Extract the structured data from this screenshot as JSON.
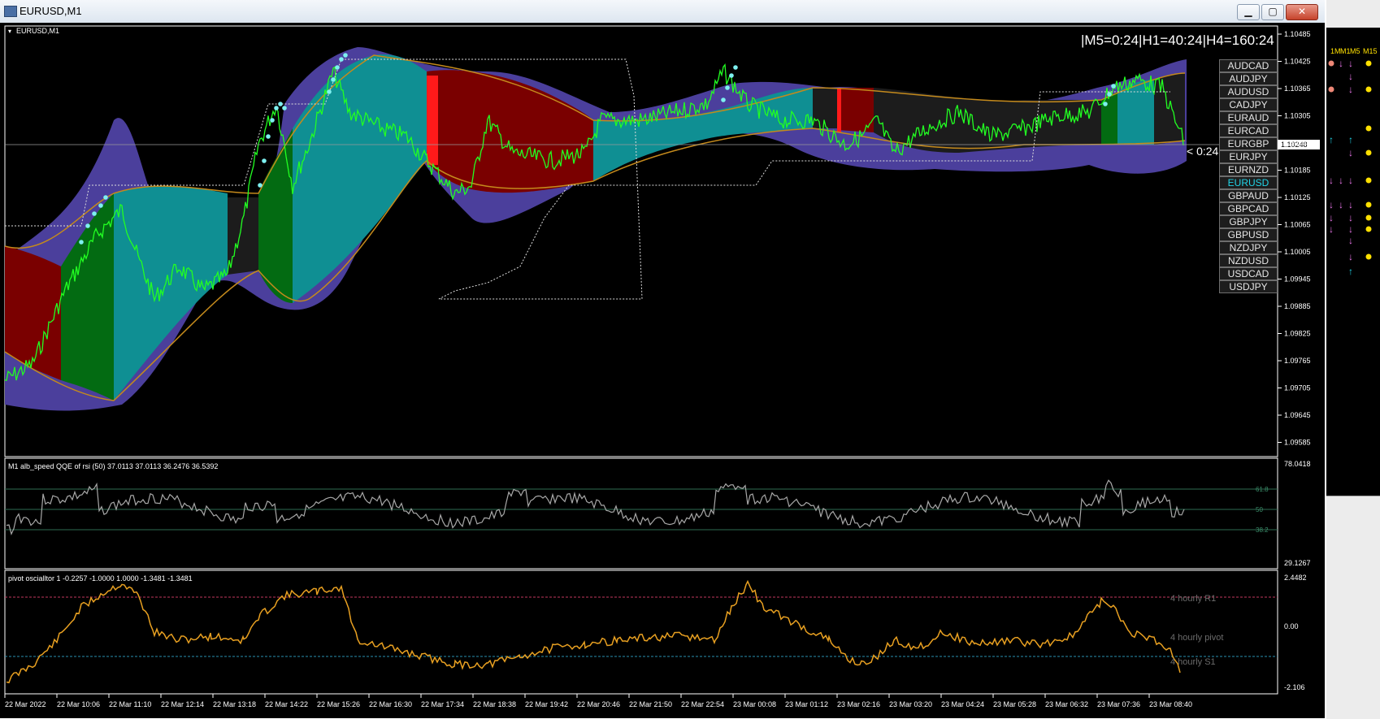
{
  "window": {
    "title": "EURUSD,M1",
    "min": "▁",
    "max": "▢",
    "close": "✕"
  },
  "main": {
    "label": "EURUSD,M1",
    "readout": "|M5=0:24|H1=40:24|H4=160:24",
    "countdown": "< 0:24",
    "price_current": "1.10248",
    "price_ticks": [
      "1.10485",
      "1.10425",
      "1.10365",
      "1.10305",
      "1.10245",
      "1.10185",
      "1.10125",
      "1.10065",
      "1.10005",
      "1.09945",
      "1.09885",
      "1.09825",
      "1.09765",
      "1.09705",
      "1.09645",
      "1.09585"
    ]
  },
  "pairs": [
    "AUDCAD",
    "AUDJPY",
    "AUDUSD",
    "CADJPY",
    "EURAUD",
    "EURCAD",
    "EURGBP",
    "EURJPY",
    "EURNZD",
    "EURUSD",
    "GBPAUD",
    "GBPCAD",
    "GBPJPY",
    "GBPUSD",
    "NZDJPY",
    "NZDUSD",
    "USDCAD",
    "USDJPY"
  ],
  "active_pair": "EURUSD",
  "qqe": {
    "label": "M1 alb_speed QQE of rsi (50) 37.0113 37.0113 36.2476 36.5392",
    "max": "78.0418",
    "min": "29.1267",
    "levels": [
      "61.8",
      "50",
      "38.2"
    ]
  },
  "pivot": {
    "label": "pivot oscialltor 1 -0.2257 -1.0000 1.0000 -1.3481 -1.3481",
    "max": "2.4482",
    "mid": "0.00",
    "min": "-2.106",
    "lines": [
      "4 hourly R1",
      "4 hourly pivot",
      "4 hourly S1"
    ]
  },
  "time_axis": [
    "22 Mar 2022",
    "22 Mar 10:06",
    "22 Mar 11:10",
    "22 Mar 12:14",
    "22 Mar 13:18",
    "22 Mar 14:22",
    "22 Mar 15:26",
    "22 Mar 16:30",
    "22 Mar 17:34",
    "22 Mar 18:38",
    "22 Mar 19:42",
    "22 Mar 20:46",
    "22 Mar 21:50",
    "22 Mar 22:54",
    "23 Mar 00:08",
    "23 Mar 01:12",
    "23 Mar 02:16",
    "23 Mar 03:20",
    "23 Mar 04:24",
    "23 Mar 05:28",
    "23 Mar 06:32",
    "23 Mar 07:36",
    "23 Mar 08:40"
  ],
  "sidebar": {
    "headers": [
      "1M",
      "M1",
      "M5",
      "M15"
    ]
  },
  "colors": {
    "bg": "#000000",
    "price": "#22ff22",
    "band_outer": "#4b3f9c",
    "band_teal": "#0f8f93",
    "band_green": "#036b12",
    "band_red": "#7a0000",
    "band_dark": "#1c1c1c",
    "band_edge": "#c48a1c",
    "qqe_line": "#a8a8a8",
    "pivot_line": "#e8a021",
    "accent_cyan": "#22d3e6"
  }
}
